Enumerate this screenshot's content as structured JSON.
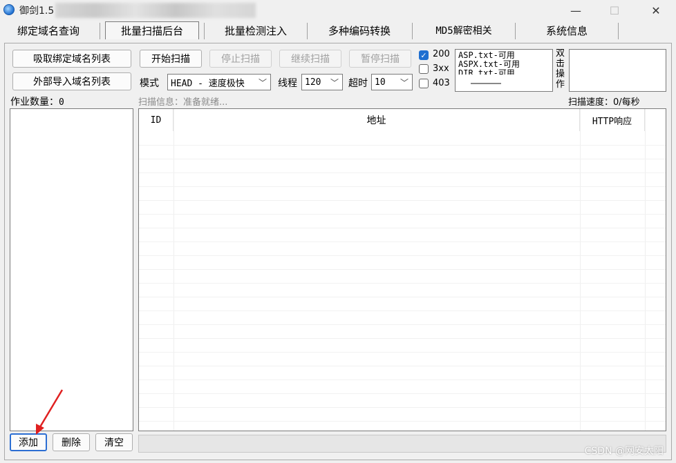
{
  "window": {
    "title": "御剑1.5",
    "minimize": "—",
    "maximize": "☐",
    "close": "✕"
  },
  "tabs": [
    {
      "label": "绑定域名查询"
    },
    {
      "label": "批量扫描后台"
    },
    {
      "label": "批量检测注入"
    },
    {
      "label": "多种编码转换"
    },
    {
      "label": "MD5解密相关"
    },
    {
      "label": "系统信息"
    }
  ],
  "left": {
    "import_bound_label": "吸取绑定域名列表",
    "import_external_label": "外部导入域名列表",
    "job_count_label": "作业数量：",
    "job_count": "0",
    "add_label": "添加",
    "delete_label": "删除",
    "clear_label": "清空"
  },
  "toolbar": {
    "start_label": "开始扫描",
    "stop_label": "停止扫描",
    "continue_label": "继续扫描",
    "pause_label": "暂停扫描",
    "mode_label": "模式",
    "mode_value": "HEAD - 速度极快",
    "threads_label": "线程",
    "threads_value": "120",
    "timeout_label": "超时",
    "timeout_value": "10"
  },
  "status_filters": [
    {
      "label": "200",
      "checked": true
    },
    {
      "label": "3xx",
      "checked": false
    },
    {
      "label": "403",
      "checked": false
    }
  ],
  "dictionaries": [
    "ASP.txt-可用",
    "ASPX.txt-可用",
    "DIR.txt-可用"
  ],
  "double_click_label": "双击操作",
  "scan_info": "扫描信息：准备就绪...",
  "scan_speed": "扫描速度：0/每秒",
  "table": {
    "columns": [
      "ID",
      "地址",
      "HTTP响应"
    ],
    "rows": []
  },
  "watermark": "CSDN @网安太阳",
  "colors": {
    "accent": "#1f6fd0",
    "annotation_arrow": "#e02020"
  }
}
